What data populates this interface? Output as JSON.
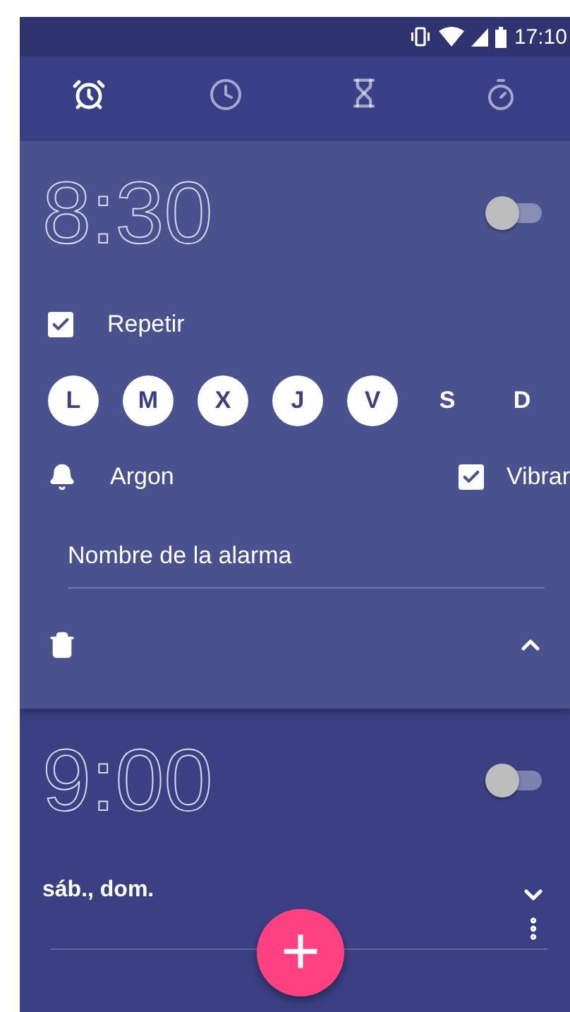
{
  "status_bar": {
    "time": "17:10"
  },
  "tabs": [
    {
      "kind": "alarm",
      "selected": true
    },
    {
      "kind": "clock",
      "selected": false
    },
    {
      "kind": "timer",
      "selected": false
    },
    {
      "kind": "stopwatch",
      "selected": false
    }
  ],
  "alarms": [
    {
      "time": "8:30",
      "on": false,
      "expanded": true,
      "repeat": {
        "label": "Repetir",
        "checked": true
      },
      "days": [
        {
          "label": "L",
          "selected": true
        },
        {
          "label": "M",
          "selected": true
        },
        {
          "label": "X",
          "selected": true
        },
        {
          "label": "J",
          "selected": true
        },
        {
          "label": "V",
          "selected": true
        },
        {
          "label": "S",
          "selected": false
        },
        {
          "label": "D",
          "selected": false
        }
      ],
      "ringtone": "Argon",
      "vibrate": {
        "label": "Vibrar",
        "checked": true
      },
      "name_field": {
        "placeholder": "Nombre de la alarma"
      }
    },
    {
      "time": "9:00",
      "on": false,
      "expanded": false,
      "days_summary": "sáb., dom."
    }
  ],
  "fab": {
    "label": "+"
  }
}
